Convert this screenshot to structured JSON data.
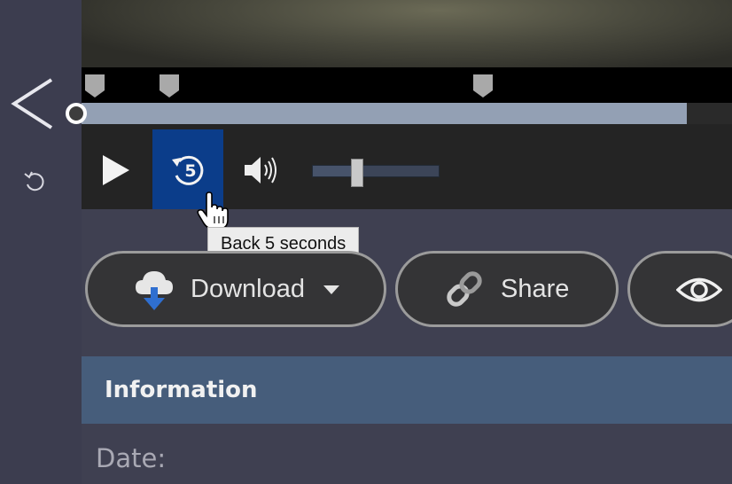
{
  "sidebar": {
    "back_icon": "chevron-left-icon",
    "undo_icon": "undo-icon"
  },
  "player": {
    "markers": [
      "bookmark-marker",
      "bookmark-marker",
      "bookmark-marker"
    ],
    "progress_fraction": 0.93,
    "volume_fraction": 0.35,
    "controls": {
      "play_icon": "play-icon",
      "back5_icon": "rewind-5-icon",
      "back5_text": "5",
      "volume_icon": "volume-icon",
      "back5_color": "#0b3d8a"
    },
    "tooltip": "Back 5 seconds"
  },
  "actions": {
    "download_label": "Download",
    "share_label": "Share"
  },
  "information": {
    "title": "Information",
    "date_label": "Date:"
  }
}
